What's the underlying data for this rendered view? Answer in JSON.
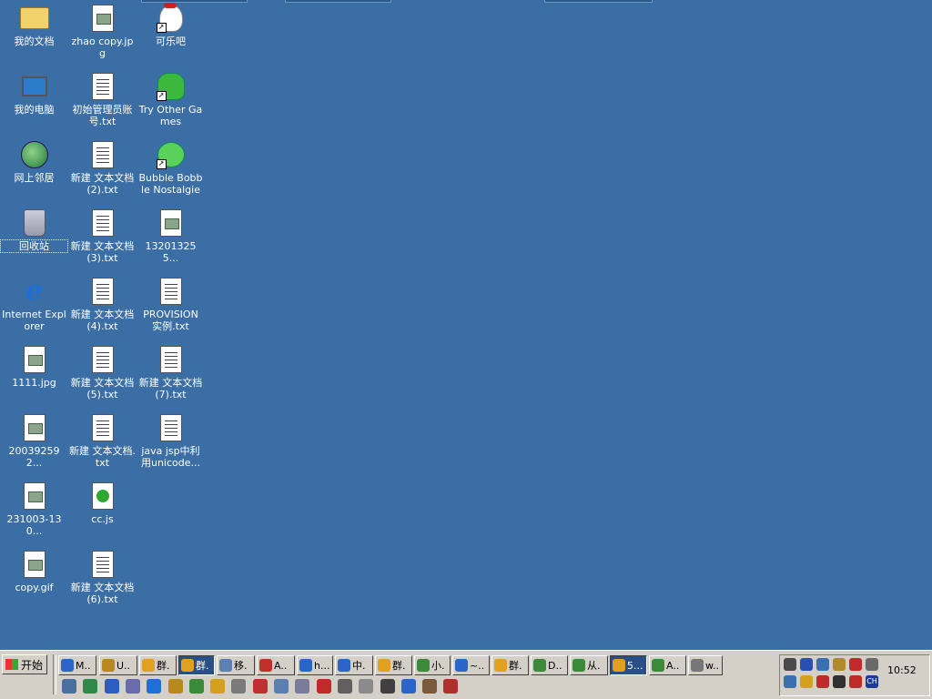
{
  "desktop": {
    "columns": [
      [
        {
          "label": "我的文档",
          "icon": "folder-icon",
          "kind": "folder"
        },
        {
          "label": "我的电脑",
          "icon": "computer-icon",
          "kind": "pc"
        },
        {
          "label": "网上邻居",
          "icon": "network-icon",
          "kind": "globe"
        },
        {
          "label": "回收站",
          "icon": "recycle-bin-icon",
          "kind": "bin",
          "selected": true
        },
        {
          "label": "Internet Explorer",
          "icon": "ie-icon",
          "kind": "ie"
        },
        {
          "label": "1111.jpg",
          "icon": "image-file-icon",
          "kind": "img"
        },
        {
          "label": "200392592...",
          "icon": "image-file-icon",
          "kind": "img"
        },
        {
          "label": "231003-130...",
          "icon": "image-file-icon",
          "kind": "img"
        },
        {
          "label": "copy.gif",
          "icon": "image-file-icon",
          "kind": "img"
        }
      ],
      [
        {
          "label": "zhao copy.jpg",
          "icon": "image-file-icon",
          "kind": "img"
        },
        {
          "label": "初始管理员账号.txt",
          "icon": "text-file-icon",
          "kind": "doc"
        },
        {
          "label": "新建 文本文档 (2).txt",
          "icon": "text-file-icon",
          "kind": "doc"
        },
        {
          "label": "新建 文本文档 (3).txt",
          "icon": "text-file-icon",
          "kind": "doc"
        },
        {
          "label": "新建 文本文档 (4).txt",
          "icon": "text-file-icon",
          "kind": "doc"
        },
        {
          "label": "新建 文本文档 (5).txt",
          "icon": "text-file-icon",
          "kind": "doc"
        },
        {
          "label": "新建 文本文档.txt",
          "icon": "text-file-icon",
          "kind": "doc"
        },
        {
          "label": "cc.js",
          "icon": "js-file-icon",
          "kind": "js"
        },
        {
          "label": "新建 文本文档 (6).txt",
          "icon": "text-file-icon",
          "kind": "doc"
        }
      ],
      [
        {
          "label": "可乐吧",
          "icon": "snowman-icon",
          "kind": "snow",
          "shortcut": true
        },
        {
          "label": "Try Other Games",
          "icon": "frog-icon",
          "kind": "frog",
          "shortcut": true
        },
        {
          "label": "Bubble Bobble Nostalgie",
          "icon": "dragon-icon",
          "kind": "dragon",
          "shortcut": true
        },
        {
          "label": "132013255...",
          "icon": "image-file-icon",
          "kind": "img"
        },
        {
          "label": "PROVISION 实例.txt",
          "icon": "text-file-icon",
          "kind": "doc"
        },
        {
          "label": "新建 文本文档 (7).txt",
          "icon": "text-file-icon",
          "kind": "doc"
        },
        {
          "label": "java jsp中利用unicode...",
          "icon": "text-file-icon",
          "kind": "doc"
        }
      ]
    ]
  },
  "taskbar": {
    "start_label": "开始",
    "buttons": [
      {
        "label": "M..",
        "color": "#2a66c7"
      },
      {
        "label": "U..",
        "color": "#b88a1e"
      },
      {
        "label": "群.",
        "color": "#e0a020"
      },
      {
        "label": "群.",
        "color": "#e0a020",
        "active": true
      },
      {
        "label": "移.",
        "color": "#5a7fb0"
      },
      {
        "label": "A..",
        "color": "#c0302a"
      },
      {
        "label": "h...",
        "color": "#2a66c7"
      },
      {
        "label": "中.",
        "color": "#2a66c7"
      },
      {
        "label": "群.",
        "color": "#e0a020"
      },
      {
        "label": "小.",
        "color": "#3a8a3a"
      },
      {
        "label": "~..",
        "color": "#2a66c7"
      },
      {
        "label": "群.",
        "color": "#e0a020"
      },
      {
        "label": "D..",
        "color": "#3a8a3a"
      },
      {
        "label": "从.",
        "color": "#3a8a3a"
      },
      {
        "label": "5...",
        "color": "#e0a020",
        "active": true
      },
      {
        "label": "A..",
        "color": "#3a8a3a"
      },
      {
        "label": "w..",
        "color": "#777777"
      }
    ],
    "quick_launch": [
      "#4a6fa0",
      "#2e8a4a",
      "#2a5fc0",
      "#6a6ab0",
      "#1f6fd6",
      "#b88a1e",
      "#3a8a3a",
      "#d4a020",
      "#7a7a7a",
      "#c03030",
      "#5a7fb0",
      "#7a7a9a",
      "#c02a2a",
      "#606060",
      "#8a8a8a",
      "#404040",
      "#2a66c7",
      "#7a5a3a",
      "#b03030"
    ],
    "tray_icons": [
      "#4a4a4a",
      "#2a4fb0",
      "#3a6fb0",
      "#b08a2a",
      "#c02a2a",
      "#6a6a6a",
      "#3a6fb0",
      "#d4a020",
      "#c02a2a",
      "#303030",
      "#c02a2a",
      "#1a3aa0"
    ],
    "tray_lang": "CH",
    "clock": "10:52"
  }
}
